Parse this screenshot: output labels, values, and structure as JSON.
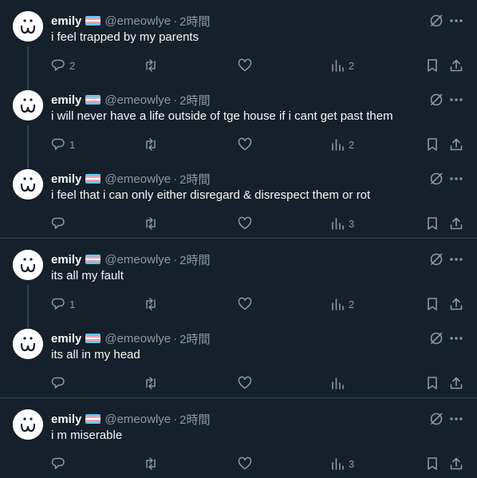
{
  "author": {
    "name": "emily",
    "handle": "@emeowlye",
    "separator": "·",
    "time": "2時間"
  },
  "tweets": [
    {
      "text": "i feel trapped by my parents",
      "replies": "2",
      "retweets": "",
      "likes": "",
      "views": "2"
    },
    {
      "text": "i will never have a life outside of tge house if i cant get past them",
      "replies": "1",
      "retweets": "",
      "likes": "",
      "views": "2"
    },
    {
      "text": "i feel that i can only either disregard & disrespect them or rot",
      "replies": "",
      "retweets": "",
      "likes": "",
      "views": "3"
    },
    {
      "text": "its all my fault",
      "replies": "1",
      "retweets": "",
      "likes": "",
      "views": "2"
    },
    {
      "text": "its all in my head",
      "replies": "",
      "retweets": "",
      "likes": "",
      "views": ""
    },
    {
      "text": "i m miserable",
      "replies": "",
      "retweets": "",
      "likes": "",
      "views": "3"
    }
  ],
  "icons": {
    "grok": "grok-icon",
    "more": "more-icon",
    "reply": "reply-icon",
    "retweet": "retweet-icon",
    "like": "like-icon",
    "views": "views-icon",
    "bookmark": "bookmark-icon",
    "share": "share-icon"
  },
  "colors": {
    "background": "#15202b",
    "text": "#f7f9f9",
    "muted": "#8b98a5",
    "divider": "#38444d",
    "flag_blue": "#5bcefa",
    "flag_pink": "#f5a9b8",
    "flag_white": "#ffffff"
  }
}
